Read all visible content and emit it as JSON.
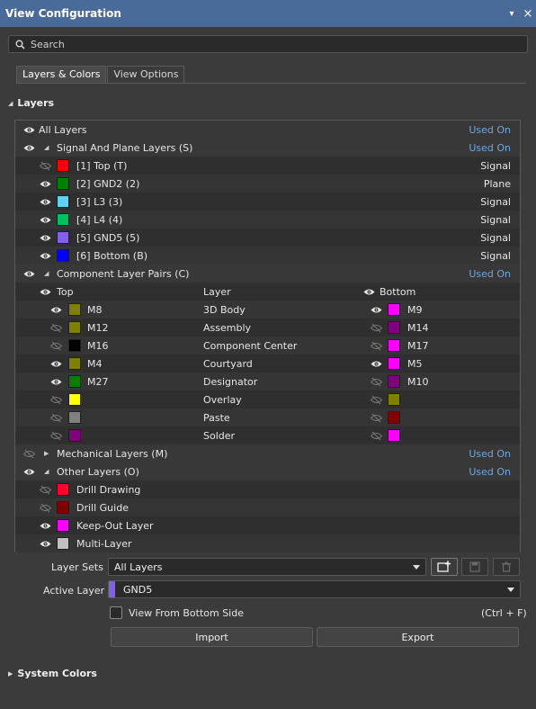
{
  "window": {
    "title": "View Configuration",
    "pin": "▾",
    "close": "×"
  },
  "search": {
    "placeholder": "Search"
  },
  "tabs": [
    {
      "label": "Layers & Colors",
      "active": true
    },
    {
      "label": "View Options",
      "active": false
    }
  ],
  "layers_section": {
    "title": "Layers"
  },
  "all_layers": {
    "label": "All Layers",
    "status": "Used On"
  },
  "signal_group": {
    "label": "Signal And Plane Layers (S)",
    "status": "Used On",
    "items": [
      {
        "label": "[1] Top (T)",
        "color": "#ff0000",
        "visible": false,
        "type": "Signal"
      },
      {
        "label": "[2] GND2 (2)",
        "color": "#008000",
        "visible": true,
        "type": "Plane"
      },
      {
        "label": "[3] L3 (3)",
        "color": "#5cd3f0",
        "visible": true,
        "type": "Signal"
      },
      {
        "label": "[4] L4 (4)",
        "color": "#00c060",
        "visible": true,
        "type": "Signal"
      },
      {
        "label": "[5] GND5 (5)",
        "color": "#8060e8",
        "visible": true,
        "type": "Signal"
      },
      {
        "label": "[6] Bottom (B)",
        "color": "#0000ff",
        "visible": true,
        "type": "Signal"
      }
    ]
  },
  "component_group": {
    "label": "Component Layer Pairs (C)",
    "status": "Used On",
    "col_top": "Top",
    "col_layer": "Layer",
    "col_bottom": "Bottom",
    "items": [
      {
        "top_label": "M8",
        "top_color": "#808000",
        "top_visible": true,
        "layer": "3D Body",
        "bottom_label": "M9",
        "bottom_color": "#ff00ff",
        "bottom_visible": true
      },
      {
        "top_label": "M12",
        "top_color": "#808000",
        "top_visible": false,
        "layer": "Assembly",
        "bottom_label": "M14",
        "bottom_color": "#800080",
        "bottom_visible": false
      },
      {
        "top_label": "M16",
        "top_color": "#000000",
        "top_visible": false,
        "layer": "Component Center",
        "bottom_label": "M17",
        "bottom_color": "#ff00ff",
        "bottom_visible": false
      },
      {
        "top_label": "M4",
        "top_color": "#808000",
        "top_visible": true,
        "layer": "Courtyard",
        "bottom_label": "M5",
        "bottom_color": "#ff00ff",
        "bottom_visible": true
      },
      {
        "top_label": "M27",
        "top_color": "#008000",
        "top_visible": true,
        "layer": "Designator",
        "bottom_label": "M10",
        "bottom_color": "#800080",
        "bottom_visible": false
      },
      {
        "top_label": "",
        "top_color": "#ffff00",
        "top_visible": false,
        "layer": "Overlay",
        "bottom_label": "",
        "bottom_color": "#808000",
        "bottom_visible": false
      },
      {
        "top_label": "",
        "top_color": "#808080",
        "top_visible": false,
        "layer": "Paste",
        "bottom_label": "",
        "bottom_color": "#800000",
        "bottom_visible": false
      },
      {
        "top_label": "",
        "top_color": "#800080",
        "top_visible": false,
        "layer": "Solder",
        "bottom_label": "",
        "bottom_color": "#ff00ff",
        "bottom_visible": false
      }
    ]
  },
  "mechanical_group": {
    "label": "Mechanical Layers (M)",
    "status": "Used On"
  },
  "other_group": {
    "label": "Other Layers (O)",
    "status": "Used On",
    "items": [
      {
        "label": "Drill Drawing",
        "color": "#ff0030",
        "visible": false
      },
      {
        "label": "Drill Guide",
        "color": "#800000",
        "visible": false
      },
      {
        "label": "Keep-Out Layer",
        "color": "#ff00ff",
        "visible": true
      },
      {
        "label": "Multi-Layer",
        "color": "#c0c0c0",
        "visible": true
      }
    ]
  },
  "layer_sets": {
    "label": "Layer Sets",
    "value": "All Layers"
  },
  "active_layer": {
    "label": "Active Layer",
    "value": "GND5",
    "color": "#8060e8"
  },
  "view_from_bottom": {
    "label": "View From Bottom Side",
    "shortcut": "(Ctrl + F)",
    "checked": false
  },
  "buttons": {
    "import": "Import",
    "export": "Export"
  },
  "system_colors": {
    "title": "System Colors"
  }
}
